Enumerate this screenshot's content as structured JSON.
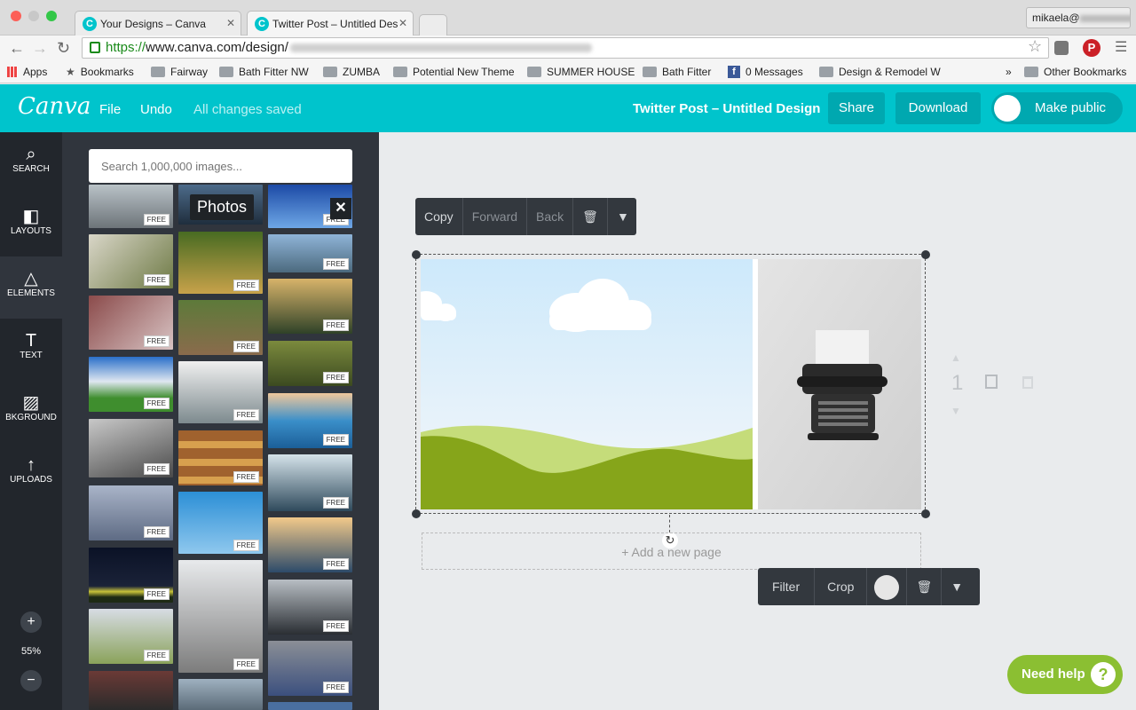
{
  "browser": {
    "tabs": [
      {
        "title": "Your Designs – Canva",
        "active": false
      },
      {
        "title": "Twitter Post – Untitled Des",
        "active": true
      }
    ],
    "profile_label": "mikaela@",
    "url_scheme": "https://",
    "url_host": "www.canva.com/design/"
  },
  "bookmarks": {
    "apps": "Apps",
    "bookmarks": "Bookmarks",
    "items": [
      "Fairway",
      "Bath Fitter NW",
      "ZUMBA",
      "Potential New Theme",
      "SUMMER HOUSE",
      "Bath Fitter",
      "0 Messages",
      "Design & Remodel W"
    ],
    "more": "»",
    "other": "Other Bookmarks"
  },
  "header": {
    "logo": "Canva",
    "file": "File",
    "undo": "Undo",
    "save_status": "All changes saved",
    "doc_title": "Twitter Post – Untitled Design",
    "share": "Share",
    "download": "Download",
    "make_public": "Make public",
    "accent_color": "#00c4cc"
  },
  "sidebar": {
    "items": [
      {
        "label": "SEARCH",
        "icon": "search-icon"
      },
      {
        "label": "LAYOUTS",
        "icon": "layouts-icon"
      },
      {
        "label": "ELEMENTS",
        "icon": "elements-icon"
      },
      {
        "label": "TEXT",
        "icon": "text-icon"
      },
      {
        "label": "BKGROUND",
        "icon": "background-icon"
      },
      {
        "label": "UPLOADS",
        "icon": "upload-icon"
      }
    ],
    "zoom_in": "+",
    "zoom_level": "55%",
    "zoom_out": "−"
  },
  "panel": {
    "search_placeholder": "Search 1,000,000 images...",
    "tooltip": "Photos",
    "close": "✕",
    "free_badge": "FREE"
  },
  "canvas": {
    "top_toolbar": {
      "copy": "Copy",
      "forward": "Forward",
      "back": "Back"
    },
    "image_toolbar": {
      "filter": "Filter",
      "crop": "Crop"
    },
    "add_page": "+ Add a new page",
    "page_number": "1"
  },
  "help": {
    "label": "Need help",
    "icon_text": "?"
  }
}
